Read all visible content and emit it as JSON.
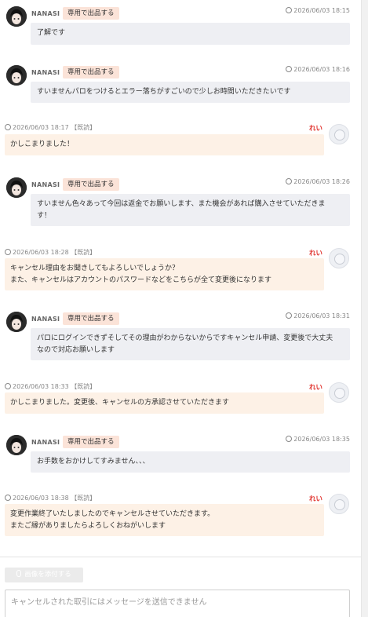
{
  "buyer": {
    "name": "NANASI",
    "badge": "専用で出品する"
  },
  "seller": {
    "name": "れい"
  },
  "read_label": "【既読】",
  "messages": [
    {
      "from": "buyer",
      "time": "2026/06/03 18:15",
      "text": "了解です"
    },
    {
      "from": "buyer",
      "time": "2026/06/03 18:16",
      "text": "すいませんパロをつけるとエラー落ちがすごいので少しお時間いただきたいです"
    },
    {
      "from": "seller",
      "time": "2026/06/03 18:17",
      "text": "かしこまりました！"
    },
    {
      "from": "buyer",
      "time": "2026/06/03 18:26",
      "text": "すいません色々あって今回は返金でお願いします、また機会があれば購入させていただきま\nす！"
    },
    {
      "from": "seller",
      "time": "2026/06/03 18:28",
      "text": "キャンセル理由をお聞きしてもよろしいでしょうか？\nまた、キャンセルはアカウントのパスワードなどをこちらが全て変更後になります"
    },
    {
      "from": "buyer",
      "time": "2026/06/03 18:31",
      "text": "パロにログインできずそしてその理由がわからないからですキャンセル申請、変更後で大丈夫\nなので対応お願いします"
    },
    {
      "from": "seller",
      "time": "2026/06/03 18:33",
      "text": "かしこまりました。変更後、キャンセルの方承認させていただきます"
    },
    {
      "from": "buyer",
      "time": "2026/06/03 18:35",
      "text": "お手数をおかけしてすみません、、、"
    },
    {
      "from": "seller",
      "time": "2026/06/03 18:38",
      "text": "変更作業終了いたしましたのでキャンセルさせていただきます。\nまたご縁がありましたらよろしくおねがいします"
    }
  ],
  "composer": {
    "attach_label": "画像を添付する",
    "placeholder": "キャンセルされた取引にはメッセージを送信できません"
  }
}
